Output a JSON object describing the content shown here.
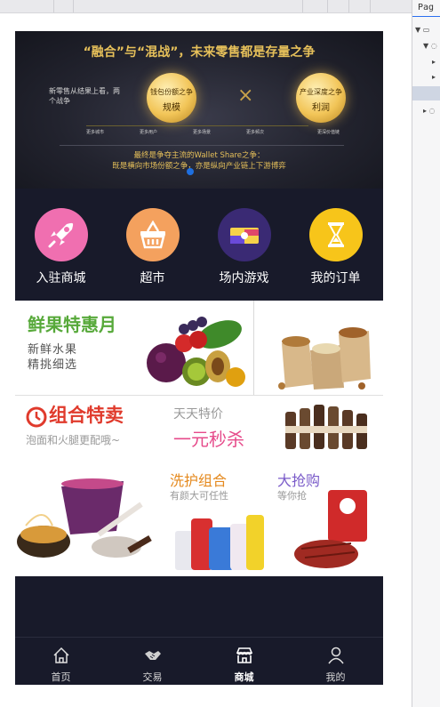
{
  "banner": {
    "title": "“融合”与“混战”，未来零售都是存量之争",
    "left_text": "新零售从结果上看，两个战争",
    "coin_left": [
      "钱包份额之争",
      "规模"
    ],
    "coin_right": [
      "产业深度之争",
      "利润"
    ],
    "cross": "×",
    "small_labels": [
      "更多城市",
      "更多用户",
      "更多场景",
      "更多频次",
      "更深价值链"
    ],
    "bottom_line1": "最终是争夺主流的Wallet Share之争：",
    "bottom_line2": "既是横向市场份额之争，亦是纵向产业链上下游博弈"
  },
  "nav": {
    "items": [
      {
        "label": "入驻商城",
        "icon": "rocket-icon",
        "color": "#f06fb0"
      },
      {
        "label": "超市",
        "icon": "basket-icon",
        "color": "#f4a15e"
      },
      {
        "label": "场内游戏",
        "icon": "game-card-icon",
        "color": "#3a2a74"
      },
      {
        "label": "我的订单",
        "icon": "hourglass-icon",
        "color": "#f7c51a"
      }
    ]
  },
  "promo": {
    "fruit_title": "鲜果特惠月",
    "fruit_sub_1": "新鲜水果",
    "fruit_sub_2": "精挑细选"
  },
  "combo": {
    "title": "组合特卖",
    "subtitle": "泡面和火腿更配哦~",
    "daily_title": "天天特价",
    "daily_sub": "一元秒杀",
    "wash_title": "洗护组合",
    "wash_sub": "有颜大可任性",
    "grab_title": "大抢购",
    "grab_sub": "等你抢"
  },
  "tabbar": {
    "items": [
      {
        "label": "首页",
        "icon": "home-icon",
        "active": false
      },
      {
        "label": "交易",
        "icon": "handshake-icon",
        "active": false
      },
      {
        "label": "商城",
        "icon": "store-icon",
        "active": true
      },
      {
        "label": "我的",
        "icon": "user-icon",
        "active": false
      }
    ]
  },
  "devtools": {
    "tab_label": "Pag"
  }
}
